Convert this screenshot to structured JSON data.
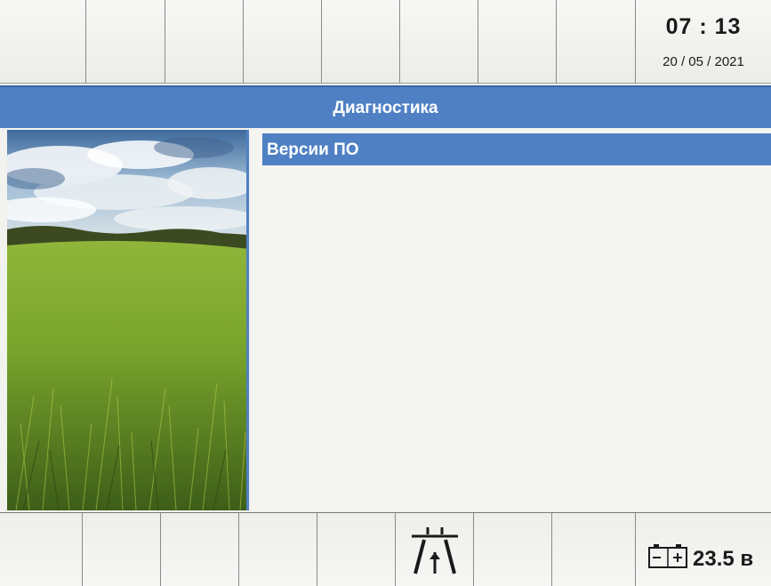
{
  "header": {
    "time": "07 : 13",
    "date": "20 / 05 / 2021"
  },
  "title": "Диагностика",
  "menu": {
    "items": [
      {
        "label": "Версии ПО",
        "selected": true
      }
    ]
  },
  "status": {
    "battery_voltage": "23.5 в",
    "icons": [
      "road-mode-icon",
      "battery-icon"
    ]
  },
  "colors": {
    "accent": "#4f80c4",
    "background": "#f2f2ef"
  }
}
